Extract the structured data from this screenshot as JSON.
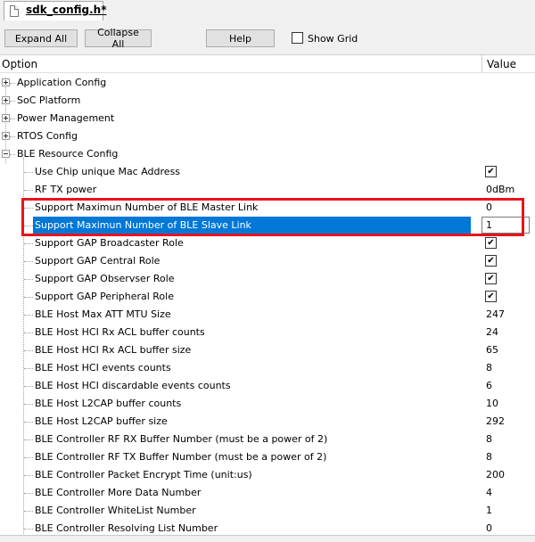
{
  "tab": {
    "filename": "sdk_config.h*"
  },
  "toolbar": {
    "expand_all": "Expand All",
    "collapse_all": "Collapse All",
    "help": "Help",
    "show_grid": "Show Grid"
  },
  "header": {
    "option": "Option",
    "value": "Value"
  },
  "tree": {
    "groups": [
      {
        "label": "Application Config",
        "expanded": false
      },
      {
        "label": "SoC Platform",
        "expanded": false
      },
      {
        "label": "Power Management",
        "expanded": false
      },
      {
        "label": "RTOS Config",
        "expanded": false
      },
      {
        "label": "BLE Resource Config",
        "expanded": true
      }
    ],
    "items": [
      {
        "label": "Use Chip unique Mac Address",
        "checked": true
      },
      {
        "label": "RF TX power",
        "value": "0dBm"
      },
      {
        "label": "Support Maximun Number of BLE Master Link",
        "value": "0"
      },
      {
        "label": "Support Maximun Number of BLE Slave Link",
        "value": "1",
        "selected": true
      },
      {
        "label": "Support GAP Broadcaster Role",
        "checked": true
      },
      {
        "label": "Support GAP Central Role",
        "checked": true
      },
      {
        "label": "Support GAP Observser Role",
        "checked": true
      },
      {
        "label": "Support GAP Peripheral Role",
        "checked": true
      },
      {
        "label": "BLE Host Max ATT MTU Size",
        "value": "247"
      },
      {
        "label": "BLE Host HCI Rx ACL buffer counts",
        "value": "24"
      },
      {
        "label": "BLE Host HCI Rx ACL buffer size",
        "value": "65"
      },
      {
        "label": "BLE Host HCI events counts",
        "value": "8"
      },
      {
        "label": "BLE Host HCI discardable events counts",
        "value": "6"
      },
      {
        "label": "BLE Host L2CAP buffer counts",
        "value": "10"
      },
      {
        "label": "BLE Host L2CAP buffer size",
        "value": "292"
      },
      {
        "label": "BLE Controller RF RX Buffer Number (must be a power of 2)",
        "value": "8"
      },
      {
        "label": "BLE Controller RF TX Buffer Number (must be a power of 2)",
        "value": "8"
      },
      {
        "label": "BLE Controller Packet Encrypt Time (unit:us)",
        "value": "200"
      },
      {
        "label": "BLE Controller More Data Number",
        "value": "4"
      },
      {
        "label": "BLE Controller WhiteList Number",
        "value": "1"
      },
      {
        "label": "BLE Controller Resolving List Number",
        "value": "0"
      }
    ]
  },
  "check_glyph": "✔",
  "colors": {
    "selection": "#0078d7",
    "highlight_border": "#e8141c"
  }
}
